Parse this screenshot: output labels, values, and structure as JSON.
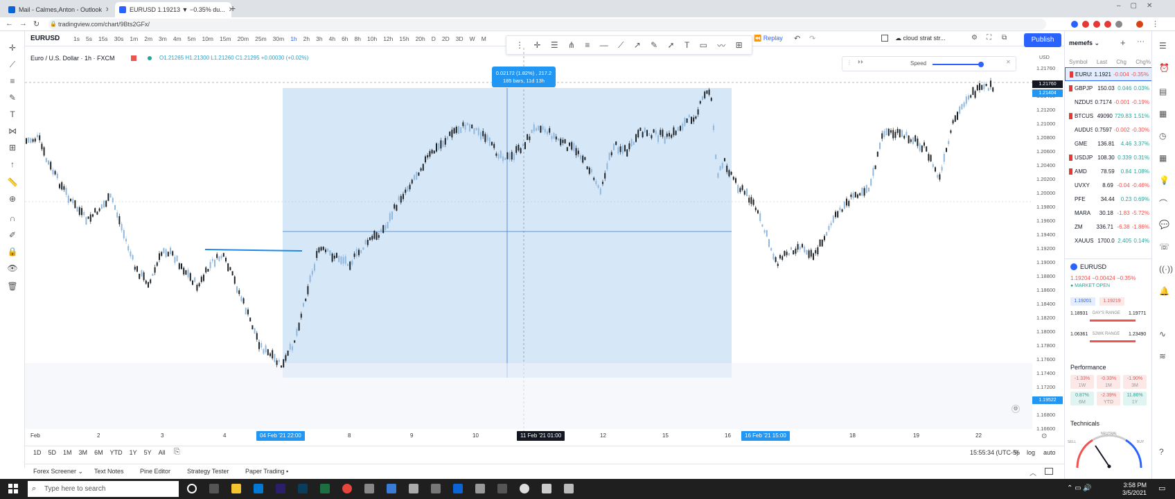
{
  "browser": {
    "tabs": [
      {
        "title": "Mail - Calmes,Anton - Outlook",
        "active": false
      },
      {
        "title": "EURUSD 1.19213 ▼ −0.35% du...",
        "active": true
      }
    ],
    "url": "tradingview.com/chart/9Bts2GFx/"
  },
  "toolbar": {
    "symbol": "EURUSD",
    "intervals": [
      "1s",
      "5s",
      "15s",
      "30s",
      "1m",
      "2m",
      "3m",
      "4m",
      "5m",
      "10m",
      "15m",
      "20m",
      "25m",
      "30m",
      "1h",
      "2h",
      "3h",
      "4h",
      "6h",
      "8h",
      "10h",
      "12h",
      "15h",
      "20h",
      "D",
      "2D",
      "3D",
      "W",
      "M"
    ],
    "selected_interval": "1h",
    "replay_label": "Replay",
    "layout_name": "cloud strat str...",
    "publish_label": "Publish"
  },
  "legend": {
    "title": "Euro / U.S. Dollar · 1h · FXCM",
    "ohlc": "O1.21265 H1.21300 L1.21260 C1.21295 +0.00030 (+0.02%)"
  },
  "replay": {
    "speed_label": "Speed"
  },
  "measure": {
    "line1": "0.02172 (1.82%) , 217.2",
    "line2": "185 bars, 11d 13h"
  },
  "price_axis": {
    "header": "USD",
    "labels": [
      "1.21760",
      "1.21600",
      "1.21400",
      "1.21200",
      "1.21000",
      "1.20800",
      "1.20600",
      "1.20400",
      "1.20200",
      "1.20000",
      "1.19800",
      "1.19600",
      "1.19400",
      "1.19200",
      "1.19000",
      "1.18800",
      "1.18600",
      "1.18400",
      "1.18200",
      "1.18000",
      "1.17800",
      "1.17600",
      "1.17400",
      "1.17200",
      "1.17000",
      "1.16800",
      "1.16600"
    ],
    "hover_tag": "1.21760",
    "last_price_tag": "1.21404",
    "low_tag": "1.19522"
  },
  "time_axis": {
    "labels": [
      "Feb",
      "2",
      "3",
      "4",
      "8",
      "9",
      "10",
      "12",
      "15",
      "16",
      "18",
      "19",
      "22"
    ],
    "selected": [
      "04 Feb '21  22:00",
      "11 Feb '21  01:00",
      "16 Feb '21  15:00"
    ]
  },
  "ranges": [
    "1D",
    "5D",
    "1M",
    "3M",
    "6M",
    "YTD",
    "1Y",
    "5Y",
    "All"
  ],
  "status": {
    "time": "15:55:34 (UTC-5)",
    "pct": "%",
    "log": "log",
    "auto": "auto"
  },
  "bottom_tabs": [
    "Forex Screener ⌄",
    "Text Notes",
    "Pine Editor",
    "Strategy Tester",
    "Paper Trading ▪"
  ],
  "watchlist": {
    "title": "memefs ⌄",
    "columns": [
      "Symbol",
      "Last",
      "Chg",
      "Chg%"
    ],
    "rows": [
      {
        "s": "EURUS",
        "l": "1.1921",
        "c": "-0.004",
        "p": "-0.35%",
        "flag": true,
        "up": false
      },
      {
        "s": "GBPJP",
        "l": "150.03",
        "c": "0.046",
        "p": "0.03%",
        "flag": true,
        "up": true
      },
      {
        "s": "NZDUS",
        "l": "0.7174",
        "c": "-0.001",
        "p": "-0.19%",
        "flag": false,
        "up": false
      },
      {
        "s": "BTCUS",
        "l": "49090",
        "c": "729.83",
        "p": "1.51%",
        "flag": true,
        "up": true
      },
      {
        "s": "AUDUS",
        "l": "0.7597",
        "c": "-0.002",
        "p": "-0.30%",
        "flag": false,
        "up": false
      },
      {
        "s": "GME",
        "l": "136.81",
        "c": "4.46",
        "p": "3.37%",
        "flag": false,
        "up": true
      },
      {
        "s": "USDJP",
        "l": "108.30",
        "c": "0.339",
        "p": "0.31%",
        "flag": true,
        "up": true
      },
      {
        "s": "AMD",
        "l": "78.59",
        "c": "0.84",
        "p": "1.08%",
        "flag": true,
        "up": true
      },
      {
        "s": "UVXY",
        "l": "8.69",
        "c": "-0.04",
        "p": "-0.46%",
        "flag": false,
        "up": false
      },
      {
        "s": "PFE",
        "l": "34.44",
        "c": "0.23",
        "p": "0.69%",
        "flag": false,
        "up": true
      },
      {
        "s": "MARA",
        "l": "30.18",
        "c": "-1.83",
        "p": "-5.72%",
        "flag": false,
        "up": false
      },
      {
        "s": "ZM",
        "l": "336.71",
        "c": "-6.38",
        "p": "-1.86%",
        "flag": false,
        "up": false
      },
      {
        "s": "XAUUS",
        "l": "1700.0",
        "c": "2.405",
        "p": "0.14%",
        "flag": false,
        "up": true
      }
    ],
    "detail": {
      "symbol": "EURUSD",
      "price_line": "1.19204 −0.00424 −0.35%",
      "market": "● MARKET OPEN",
      "bid": "1.19201",
      "ask": "1.19219",
      "days_low": "1.18931",
      "days_range_label": "DAY'S RANGE",
      "days_high": "1.19771",
      "wk_low": "1.06361",
      "wk_range_label": "52WK RANGE",
      "wk_high": "1.23490",
      "performance_title": "Performance",
      "perf": [
        {
          "v": "-1.33%",
          "l": "1W",
          "up": false
        },
        {
          "v": "-0.33%",
          "l": "1M",
          "up": false
        },
        {
          "v": "-1.90%",
          "l": "3M",
          "up": false
        },
        {
          "v": "0.87%",
          "l": "6M",
          "up": true
        },
        {
          "v": "-2.39%",
          "l": "YTD",
          "up": false
        },
        {
          "v": "11.86%",
          "l": "1Y",
          "up": true
        }
      ],
      "technicals_title": "Technicals",
      "gauge_labels": [
        "SELL",
        "NEUTRAL",
        "BUY"
      ]
    }
  },
  "taskbar": {
    "search_placeholder": "Type here to search",
    "time": "3:58 PM",
    "date": "3/5/2021"
  },
  "colors": {
    "accent": "#2962ff",
    "measure_fill": "#cfe3f7",
    "candle": "#1e2328",
    "candle_alt": "#8fb8dc",
    "down": "#ef5350",
    "up": "#26a69a"
  }
}
